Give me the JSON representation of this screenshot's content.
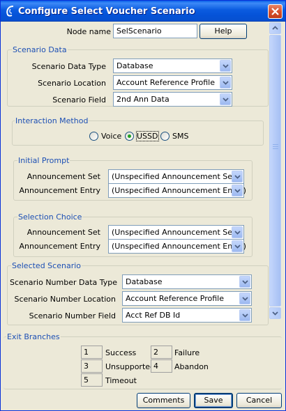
{
  "window": {
    "title": "Configure Select Voucher Scenario"
  },
  "node": {
    "label": "Node name",
    "value": "SelScenario",
    "help_label": "Help"
  },
  "scenario_data": {
    "title": "Scenario Data",
    "data_type": {
      "label": "Scenario Data Type",
      "value": "Database"
    },
    "location": {
      "label": "Scenario Location",
      "value": "Account Reference Profile"
    },
    "field": {
      "label": "Scenario Field",
      "value": "2nd Ann Data"
    }
  },
  "interaction": {
    "title": "Interaction Method",
    "options": [
      {
        "label": "Voice",
        "selected": false
      },
      {
        "label": "USSD",
        "selected": true
      },
      {
        "label": "SMS",
        "selected": false
      }
    ]
  },
  "initial_prompt": {
    "title": "Initial Prompt",
    "set": {
      "label": "Announcement Set",
      "value": "(Unspecified Announcement Set)"
    },
    "entry": {
      "label": "Announcement Entry",
      "value": "(Unspecified Announcement Entry)"
    }
  },
  "selection_choice": {
    "title": "Selection Choice",
    "set": {
      "label": "Announcement Set",
      "value": "(Unspecified Announcement Set)"
    },
    "entry": {
      "label": "Announcement Entry",
      "value": "(Unspecified Announcement Entry)"
    }
  },
  "selected_scenario": {
    "title": "Selected Scenario",
    "data_type": {
      "label": "Scenario Number Data Type",
      "value": "Database"
    },
    "location": {
      "label": "Scenario Number Location",
      "value": "Account Reference Profile"
    },
    "field": {
      "label": "Scenario Number Field",
      "value": "Acct Ref DB Id"
    }
  },
  "exit_branches": {
    "title": "Exit Branches",
    "items": [
      {
        "num": "1",
        "label": "Success"
      },
      {
        "num": "2",
        "label": "Failure"
      },
      {
        "num": "3",
        "label": "Unsupported"
      },
      {
        "num": "4",
        "label": "Abandon"
      },
      {
        "num": "5",
        "label": "Timeout"
      }
    ]
  },
  "buttons": {
    "comments": "Comments",
    "save": "Save",
    "cancel": "Cancel"
  },
  "colors": {
    "title_bar": "#0553d8",
    "group_title": "#1c4fb4",
    "window_bg": "#ece9d8"
  }
}
